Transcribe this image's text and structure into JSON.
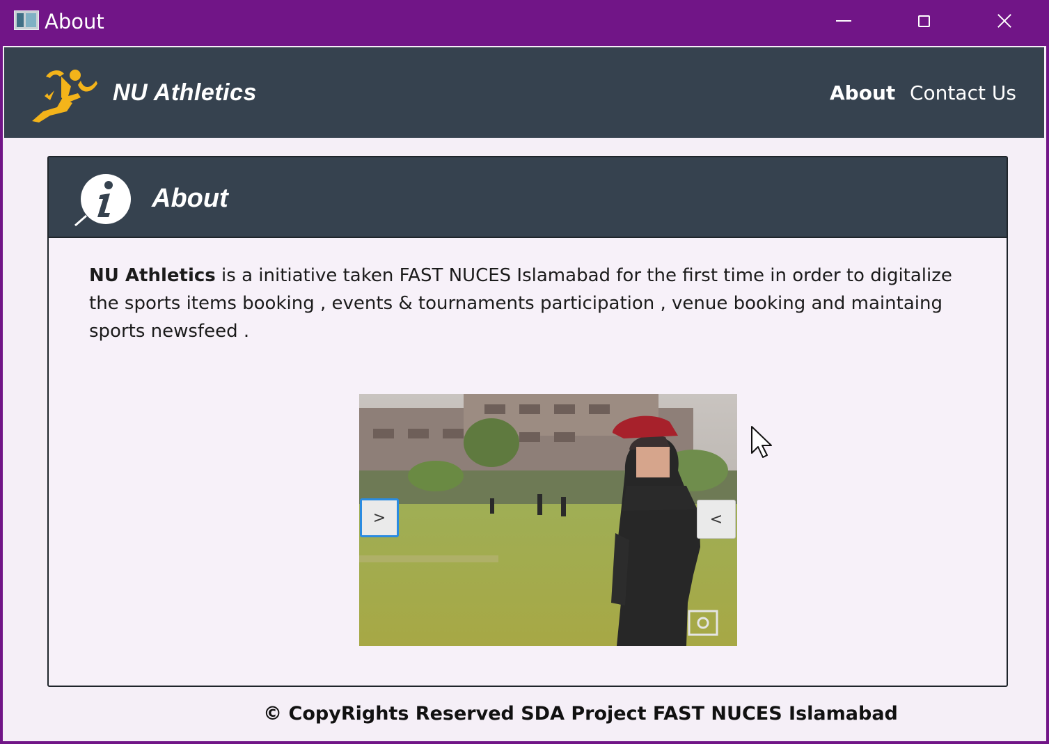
{
  "window": {
    "title": "About",
    "controls": {
      "minimize": "minimize-icon",
      "maximize": "maximize-icon",
      "close": "close-icon"
    }
  },
  "navbar": {
    "brand": "NU Athletics",
    "logo_icon": "runner-icon",
    "links": [
      {
        "label": "About",
        "active": true
      },
      {
        "label": "Contact Us",
        "active": false
      }
    ]
  },
  "about": {
    "title": "About",
    "icon": "info-icon",
    "intro_strong": "NU Athletics",
    "intro_rest": " is a initiative taken FAST NUCES Islamabad for the first time in order to digitalize the sports items booking , events & tournaments participation , venue booking and maintaing sports newsfeed ."
  },
  "carousel": {
    "next_label": ">",
    "prev_label": "<",
    "image": "cricket-player-photo"
  },
  "footer": {
    "copyright": "© CopyRights Reserved SDA Project FAST NUCES Islamabad"
  },
  "colors": {
    "titlebar": "#711587",
    "navbar": "#36424f",
    "accent_logo": "#f4b41a",
    "background": "#f5eff7"
  }
}
